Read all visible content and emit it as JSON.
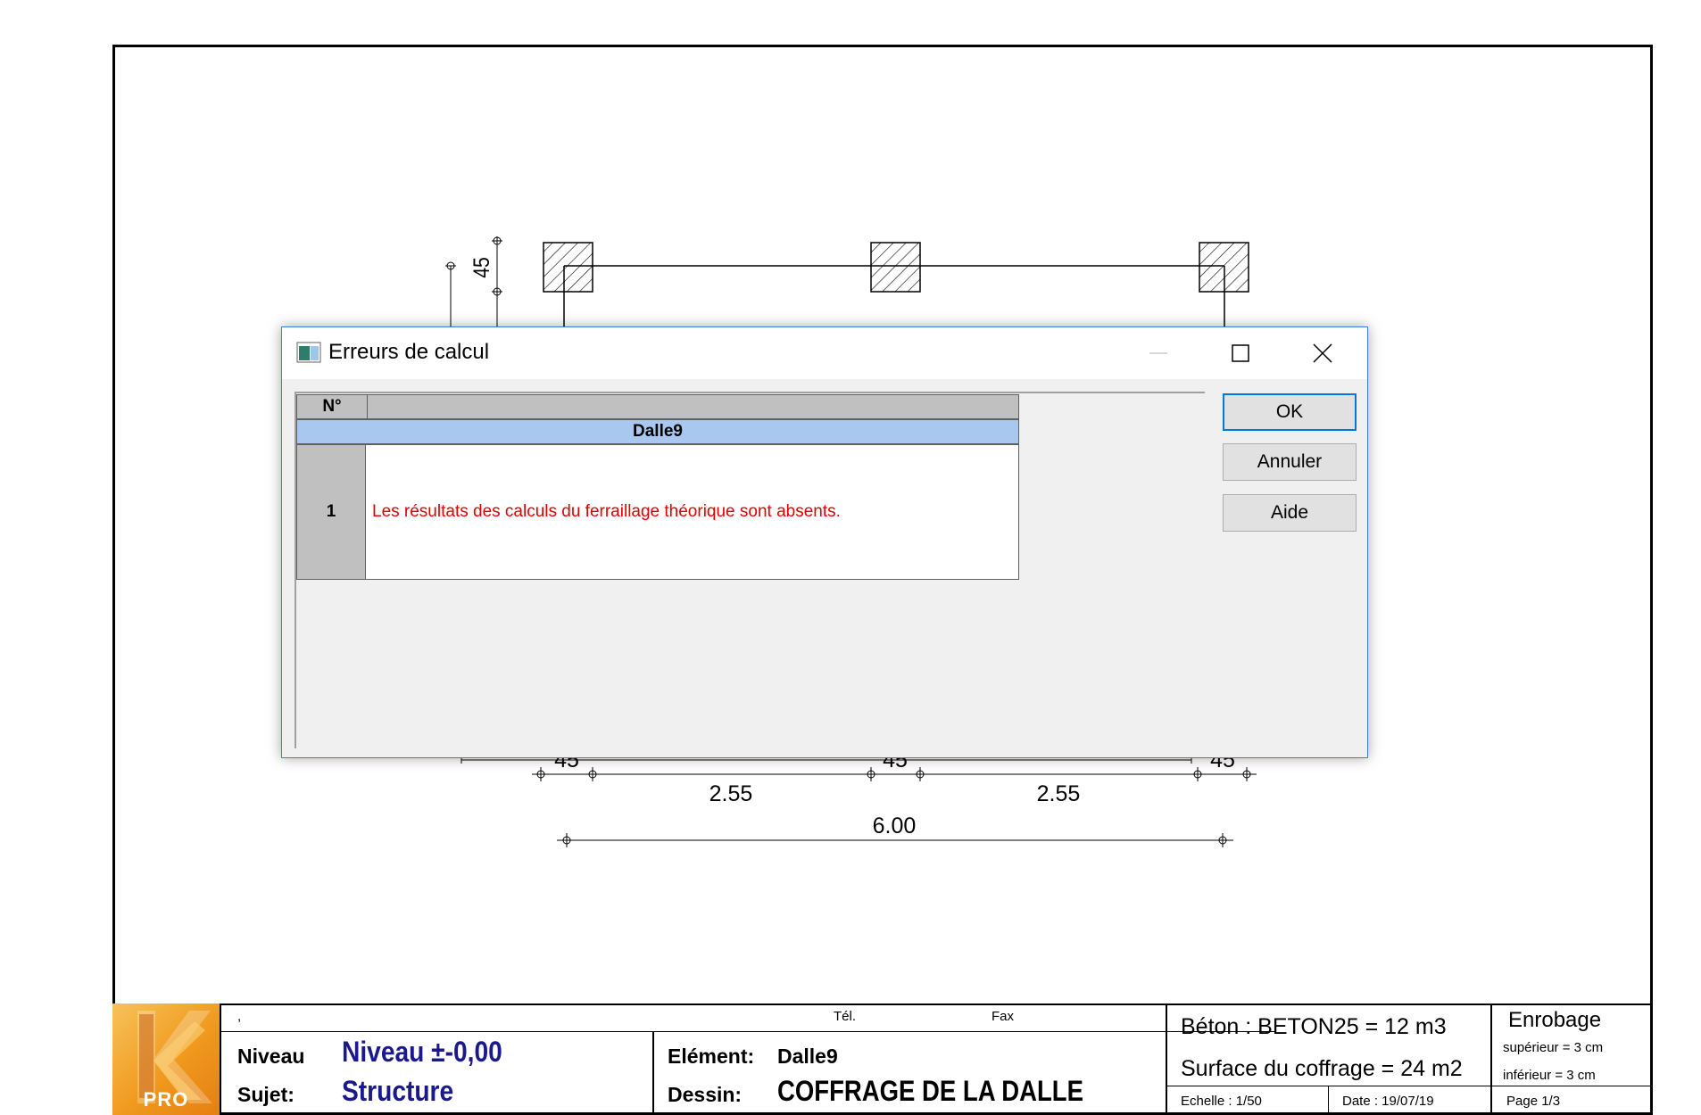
{
  "drawing": {
    "dim_vertical": "45",
    "dim_span_left": "2.55",
    "dim_span_right": "2.55",
    "dim_total": "6.00",
    "dim_col_left": "45",
    "dim_col_mid": "45",
    "dim_col_right": "45"
  },
  "dialog": {
    "title": "Erreurs de calcul",
    "grid": {
      "header_num": "N°",
      "header_desc": "",
      "group_label": "Dalle9",
      "rows": [
        {
          "num": "1",
          "message": "Les résultats des calculs du ferraillage théorique sont absents."
        }
      ]
    },
    "buttons": {
      "ok": "OK",
      "cancel": "Annuler",
      "help": "Aide"
    }
  },
  "titleblock": {
    "logo_text": "PRO",
    "company": ",",
    "tel_label": "Tél.",
    "fax_label": "Fax",
    "niveau_label": "Niveau",
    "niveau_value": "Niveau ±-0,00",
    "sujet_label": "Sujet:",
    "sujet_value": "Structure",
    "element_label": "Elément:",
    "element_value": "Dalle9",
    "dessin_label": "Dessin:",
    "dessin_value": "COFFRAGE DE LA DALLE",
    "beton": "Béton : BETON25 = 12 m3",
    "surface": "Surface du coffrage = 24 m2",
    "echelle": "Echelle : 1/50",
    "date": "Date  : 19/07/19",
    "enrobage_title": "Enrobage",
    "enrobage_sup": "supérieur = 3 cm",
    "enrobage_inf": "inférieur = 3 cm",
    "page": "Page 1/3"
  },
  "colors": {
    "accent_blue": "#0078d7",
    "group_row": "#a8c8f0",
    "error_text": "#e00000",
    "title_value_blue": "#1a1a8c",
    "logo_orange": "#f09a1e"
  }
}
